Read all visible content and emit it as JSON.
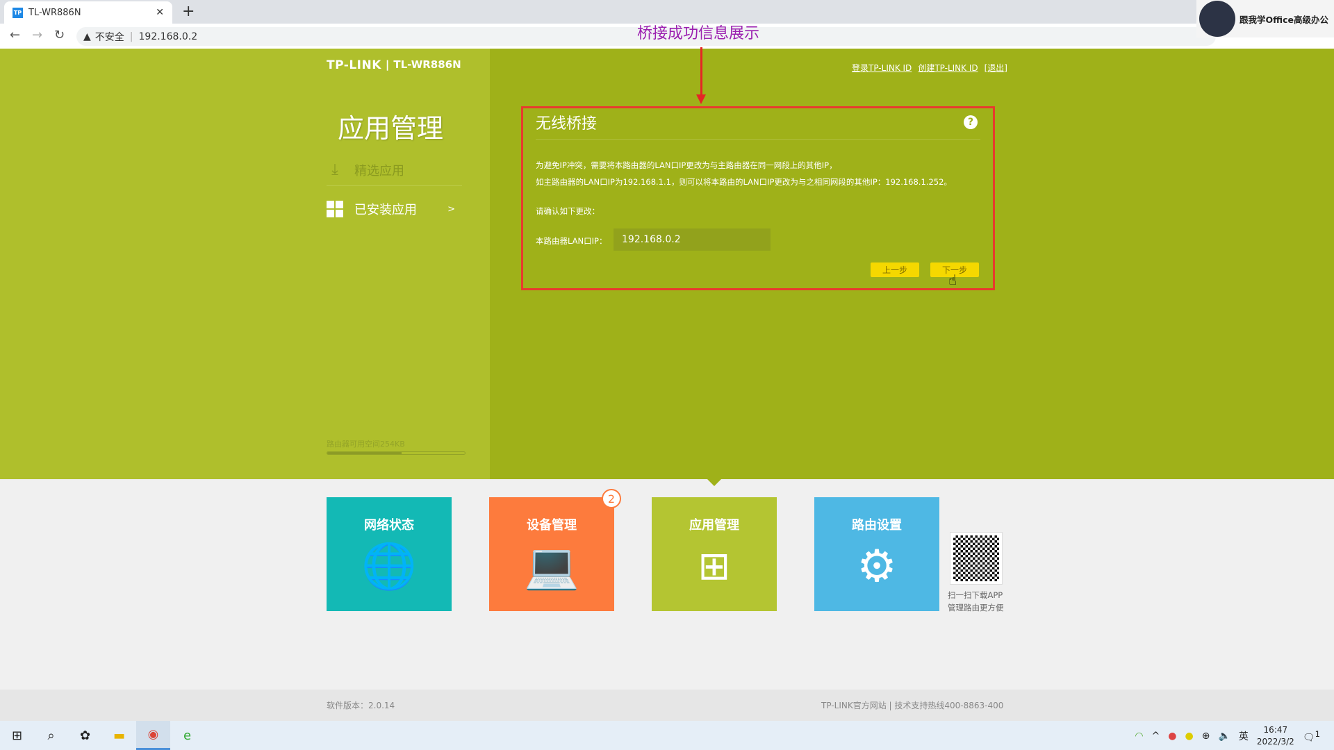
{
  "browser": {
    "tab_title": "TL-WR886N",
    "tab_favicon": "TP",
    "url": "192.168.0.2",
    "security_label": "不安全"
  },
  "annotation": {
    "text": "桥接成功信息展示",
    "color": "#9b1fb0"
  },
  "header": {
    "brand": "TP-LINK",
    "model": "TL-WR886N",
    "links": [
      "登录TP-LINK ID",
      "创建TP-LINK ID",
      "[退出]"
    ]
  },
  "sidebar": {
    "title": "应用管理",
    "items": [
      {
        "label": "精选应用",
        "icon": "download-icon"
      },
      {
        "label": "已安装应用",
        "icon": "grid-icon",
        "chevron": ">"
      }
    ],
    "storage_label": "路由器可用空间254KB",
    "storage_used_percent": 54
  },
  "panel": {
    "title": "无线桥接",
    "help": "?",
    "line1": "为避免IP冲突，需要将本路由器的LAN口IP更改为与主路由器在同一网段上的其他IP，",
    "line2": "如主路由器的LAN口IP为192.168.1.1，则可以将本路由的LAN口IP更改为与之相同网段的其他IP：192.168.1.252。",
    "confirm": "请确认如下更改：",
    "lan_label": "本路由器LAN口IP：",
    "lan_value": "192.168.0.2",
    "prev": "上一步",
    "next": "下一步"
  },
  "tiles": [
    {
      "label": "网络状态",
      "icon": "globe-icon"
    },
    {
      "label": "设备管理",
      "icon": "laptop-icon",
      "badge": "2"
    },
    {
      "label": "应用管理",
      "icon": "apps-icon"
    },
    {
      "label": "路由设置",
      "icon": "gear-icon"
    }
  ],
  "qr": {
    "line1": "扫一扫下载APP",
    "line2": "管理路由更方便"
  },
  "footer": {
    "version": "软件版本：2.0.14",
    "links": "TP-LINK官方网站 | 技术支持热线400-8863-400"
  },
  "webcam": {
    "label": "跟我学Office高级办公"
  },
  "taskbar": {
    "time": "16:47",
    "date": "2022/3/2",
    "ime": "英",
    "notifications": "1"
  }
}
